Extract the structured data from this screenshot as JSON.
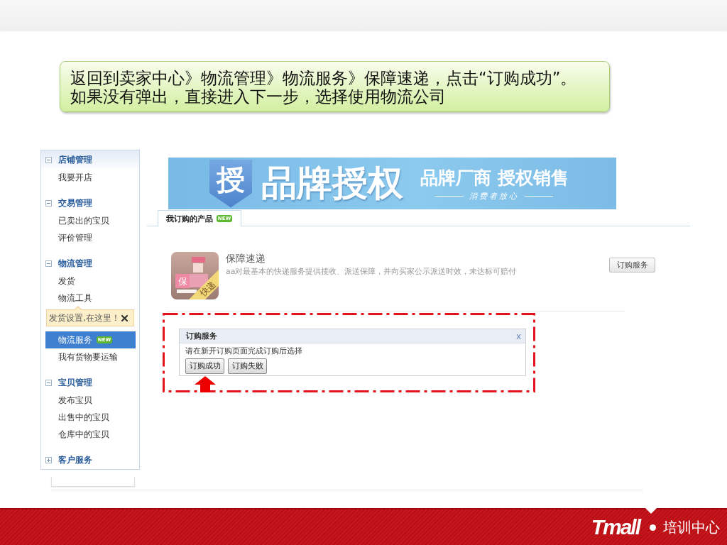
{
  "callout": {
    "lines": [
      "返回到卖家中心》物流管理》物流服务》保障速递，点击“订购成功”。",
      "如果没有弹出，直接进入下一步，选择使用物流公司"
    ]
  },
  "sidebar": {
    "sections": [
      {
        "title": "店铺管理",
        "expanded": true,
        "items": [
          {
            "label": "我要开店",
            "selected": false
          }
        ]
      },
      {
        "title": "交易管理",
        "expanded": true,
        "items": [
          {
            "label": "已卖出的宝贝",
            "selected": false
          },
          {
            "label": "评价管理",
            "selected": false
          }
        ]
      },
      {
        "title": "物流管理",
        "expanded": true,
        "items": [
          {
            "label": "发货",
            "selected": false
          },
          {
            "label": "物流工具",
            "selected": false,
            "tip": {
              "text": "发货设置,在这里！"
            }
          },
          {
            "label": "物流服务",
            "selected": true,
            "badge": "NEW"
          },
          {
            "label": "我有货物要运输",
            "selected": false
          }
        ]
      },
      {
        "title": "宝贝管理",
        "expanded": true,
        "items": [
          {
            "label": "发布宝贝",
            "selected": false
          },
          {
            "label": "出售中的宝贝",
            "selected": false
          },
          {
            "label": "仓库中的宝贝",
            "selected": false
          }
        ]
      },
      {
        "title": "客户服务",
        "expanded": false
      }
    ]
  },
  "banner": {
    "emblem": "授",
    "title": "品牌授权",
    "slogan": "品牌厂商 授权销售",
    "signature": "消费者放心"
  },
  "tabs": [
    {
      "label": "我订购的产品",
      "badge": "NEW",
      "selected": true
    }
  ],
  "product": {
    "logo_marks": [
      "保",
      "快递"
    ],
    "name": "保障速递",
    "description": "aa对最基本的快递服务提供揽收、派送保障，并向买家公示派送时效，未达标可赔付",
    "button": "订购服务"
  },
  "dialog": {
    "title": "订购服务",
    "close": "x",
    "message": "请在新开订购页面完成订购后选择",
    "buttons": [
      {
        "label": "订购成功",
        "marked": true
      },
      {
        "label": "订购失败",
        "marked": false
      }
    ]
  },
  "footer": {
    "brand": "Tmall",
    "title": "培训中心"
  }
}
